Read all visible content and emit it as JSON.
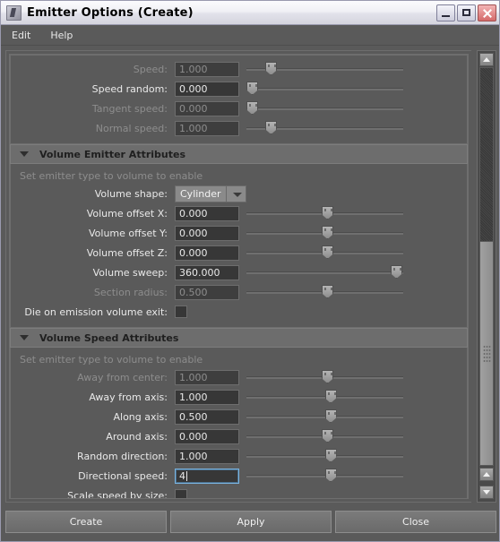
{
  "window": {
    "title": "Emitter Options (Create)",
    "icon": "maya-emitter-icon",
    "controls": {
      "minimize": "_",
      "maximize": "□",
      "close": "✕"
    }
  },
  "menubar": {
    "items": [
      "Edit",
      "Help"
    ]
  },
  "colors": {
    "panel_bg": "#5a5a5a",
    "field_bg": "#373737",
    "label": "#e9e9e9",
    "label_disabled": "#8d8d8d",
    "section_header": "#6d6d6d",
    "focus_border": "#7ab4e0"
  },
  "top_group": {
    "rows": [
      {
        "label": "Speed:",
        "value": "1.000",
        "enabled": false,
        "slider": 12
      },
      {
        "label": "Speed random:",
        "value": "0.000",
        "enabled": true,
        "slider": 0
      },
      {
        "label": "Tangent speed:",
        "value": "0.000",
        "enabled": false,
        "slider": 0
      },
      {
        "label": "Normal speed:",
        "value": "1.000",
        "enabled": false,
        "slider": 12
      }
    ]
  },
  "volume_emitter": {
    "section_title": "Volume Emitter Attributes",
    "collapse_icon": "triangle-down-icon",
    "hint": "Set emitter type to volume to enable",
    "shape_label": "Volume shape:",
    "shape_value": "Cylinder",
    "rows": [
      {
        "label": "Volume offset X:",
        "value": "0.000",
        "enabled": true,
        "slider": 50
      },
      {
        "label": "Volume offset Y:",
        "value": "0.000",
        "enabled": true,
        "slider": 50
      },
      {
        "label": "Volume offset Z:",
        "value": "0.000",
        "enabled": true,
        "slider": 50
      },
      {
        "label": "Volume sweep:",
        "value": "360.000",
        "enabled": true,
        "slider": 100
      },
      {
        "label": "Section radius:",
        "value": "0.500",
        "enabled": false,
        "slider": 50
      }
    ],
    "checkbox_label": "Die on emission volume exit:",
    "checkbox_checked": false
  },
  "volume_speed": {
    "section_title": "Volume Speed Attributes",
    "collapse_icon": "triangle-down-icon",
    "hint": "Set emitter type to volume to enable",
    "rows": [
      {
        "label": "Away from center:",
        "value": "1.000",
        "enabled": false,
        "slider": 50
      },
      {
        "label": "Away from axis:",
        "value": "1.000",
        "enabled": true,
        "slider": 52
      },
      {
        "label": "Along axis:",
        "value": "0.500",
        "enabled": true,
        "slider": 52
      },
      {
        "label": "Around axis:",
        "value": "0.000",
        "enabled": true,
        "slider": 50
      },
      {
        "label": "Random direction:",
        "value": "1.000",
        "enabled": true,
        "slider": 52
      },
      {
        "label": "Directional speed:",
        "value": "4",
        "enabled": true,
        "slider": 52,
        "focused": true
      }
    ],
    "checkbox_label": "Scale speed by size:",
    "checkbox_checked": false
  },
  "scrollbar": {
    "up_icon": "triangle-up-icon",
    "down_icon": "triangle-down-icon",
    "thumb_top_pct": 42,
    "thumb_height_pct": 50
  },
  "buttons": {
    "create": "Create",
    "apply": "Apply",
    "close": "Close"
  }
}
